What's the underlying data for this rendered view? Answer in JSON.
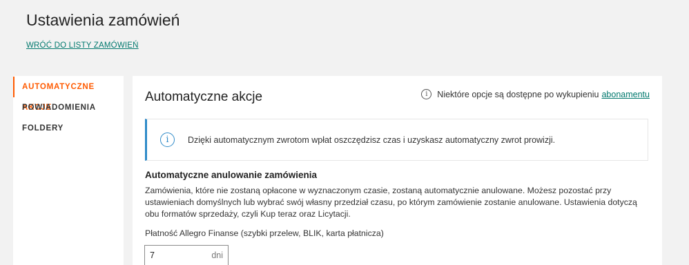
{
  "header": {
    "title": "Ustawienia zamówień",
    "back_link": "WRÓĆ DO LISTY ZAMÓWIEŃ"
  },
  "sidebar": {
    "items": [
      {
        "label": "AUTOMATYCZNE AKCJE",
        "active": true
      },
      {
        "label": "POWIADOMIENIA",
        "active": false
      },
      {
        "label": "FOLDERY",
        "active": false
      }
    ]
  },
  "main": {
    "title": "Automatyczne akcje",
    "note_text": "Niektóre opcje są dostępne po wykupieniu",
    "note_link": "abonamentu",
    "banner_text": "Dzięki automatycznym zwrotom wpłat oszczędzisz czas i uzyskasz automatyczny zwrot prowizji.",
    "cancel_title": "Automatyczne anulowanie zamówienia",
    "cancel_desc": "Zamówienia, które nie zostaną opłacone w wyznaczonym czasie, zostaną automatycznie anulowane. Możesz pozostać przy ustawieniach domyślnych lub wybrać swój własny przedział czasu, po którym zamówienie zostanie anulowane. Ustawienia dotyczą obu formatów sprzedaży, czyli Kup teraz oraz Licytacji.",
    "payment_label": "Płatność Allegro Finanse (szybki przelew, BLIK, karta płatnicza)",
    "payment_days_value": "7",
    "payment_days_unit": "dni"
  },
  "icons": {
    "info_glyph": "i"
  },
  "colors": {
    "accent": "#ff5a00",
    "link": "#00786d",
    "info_blue": "#2e8ac8"
  }
}
